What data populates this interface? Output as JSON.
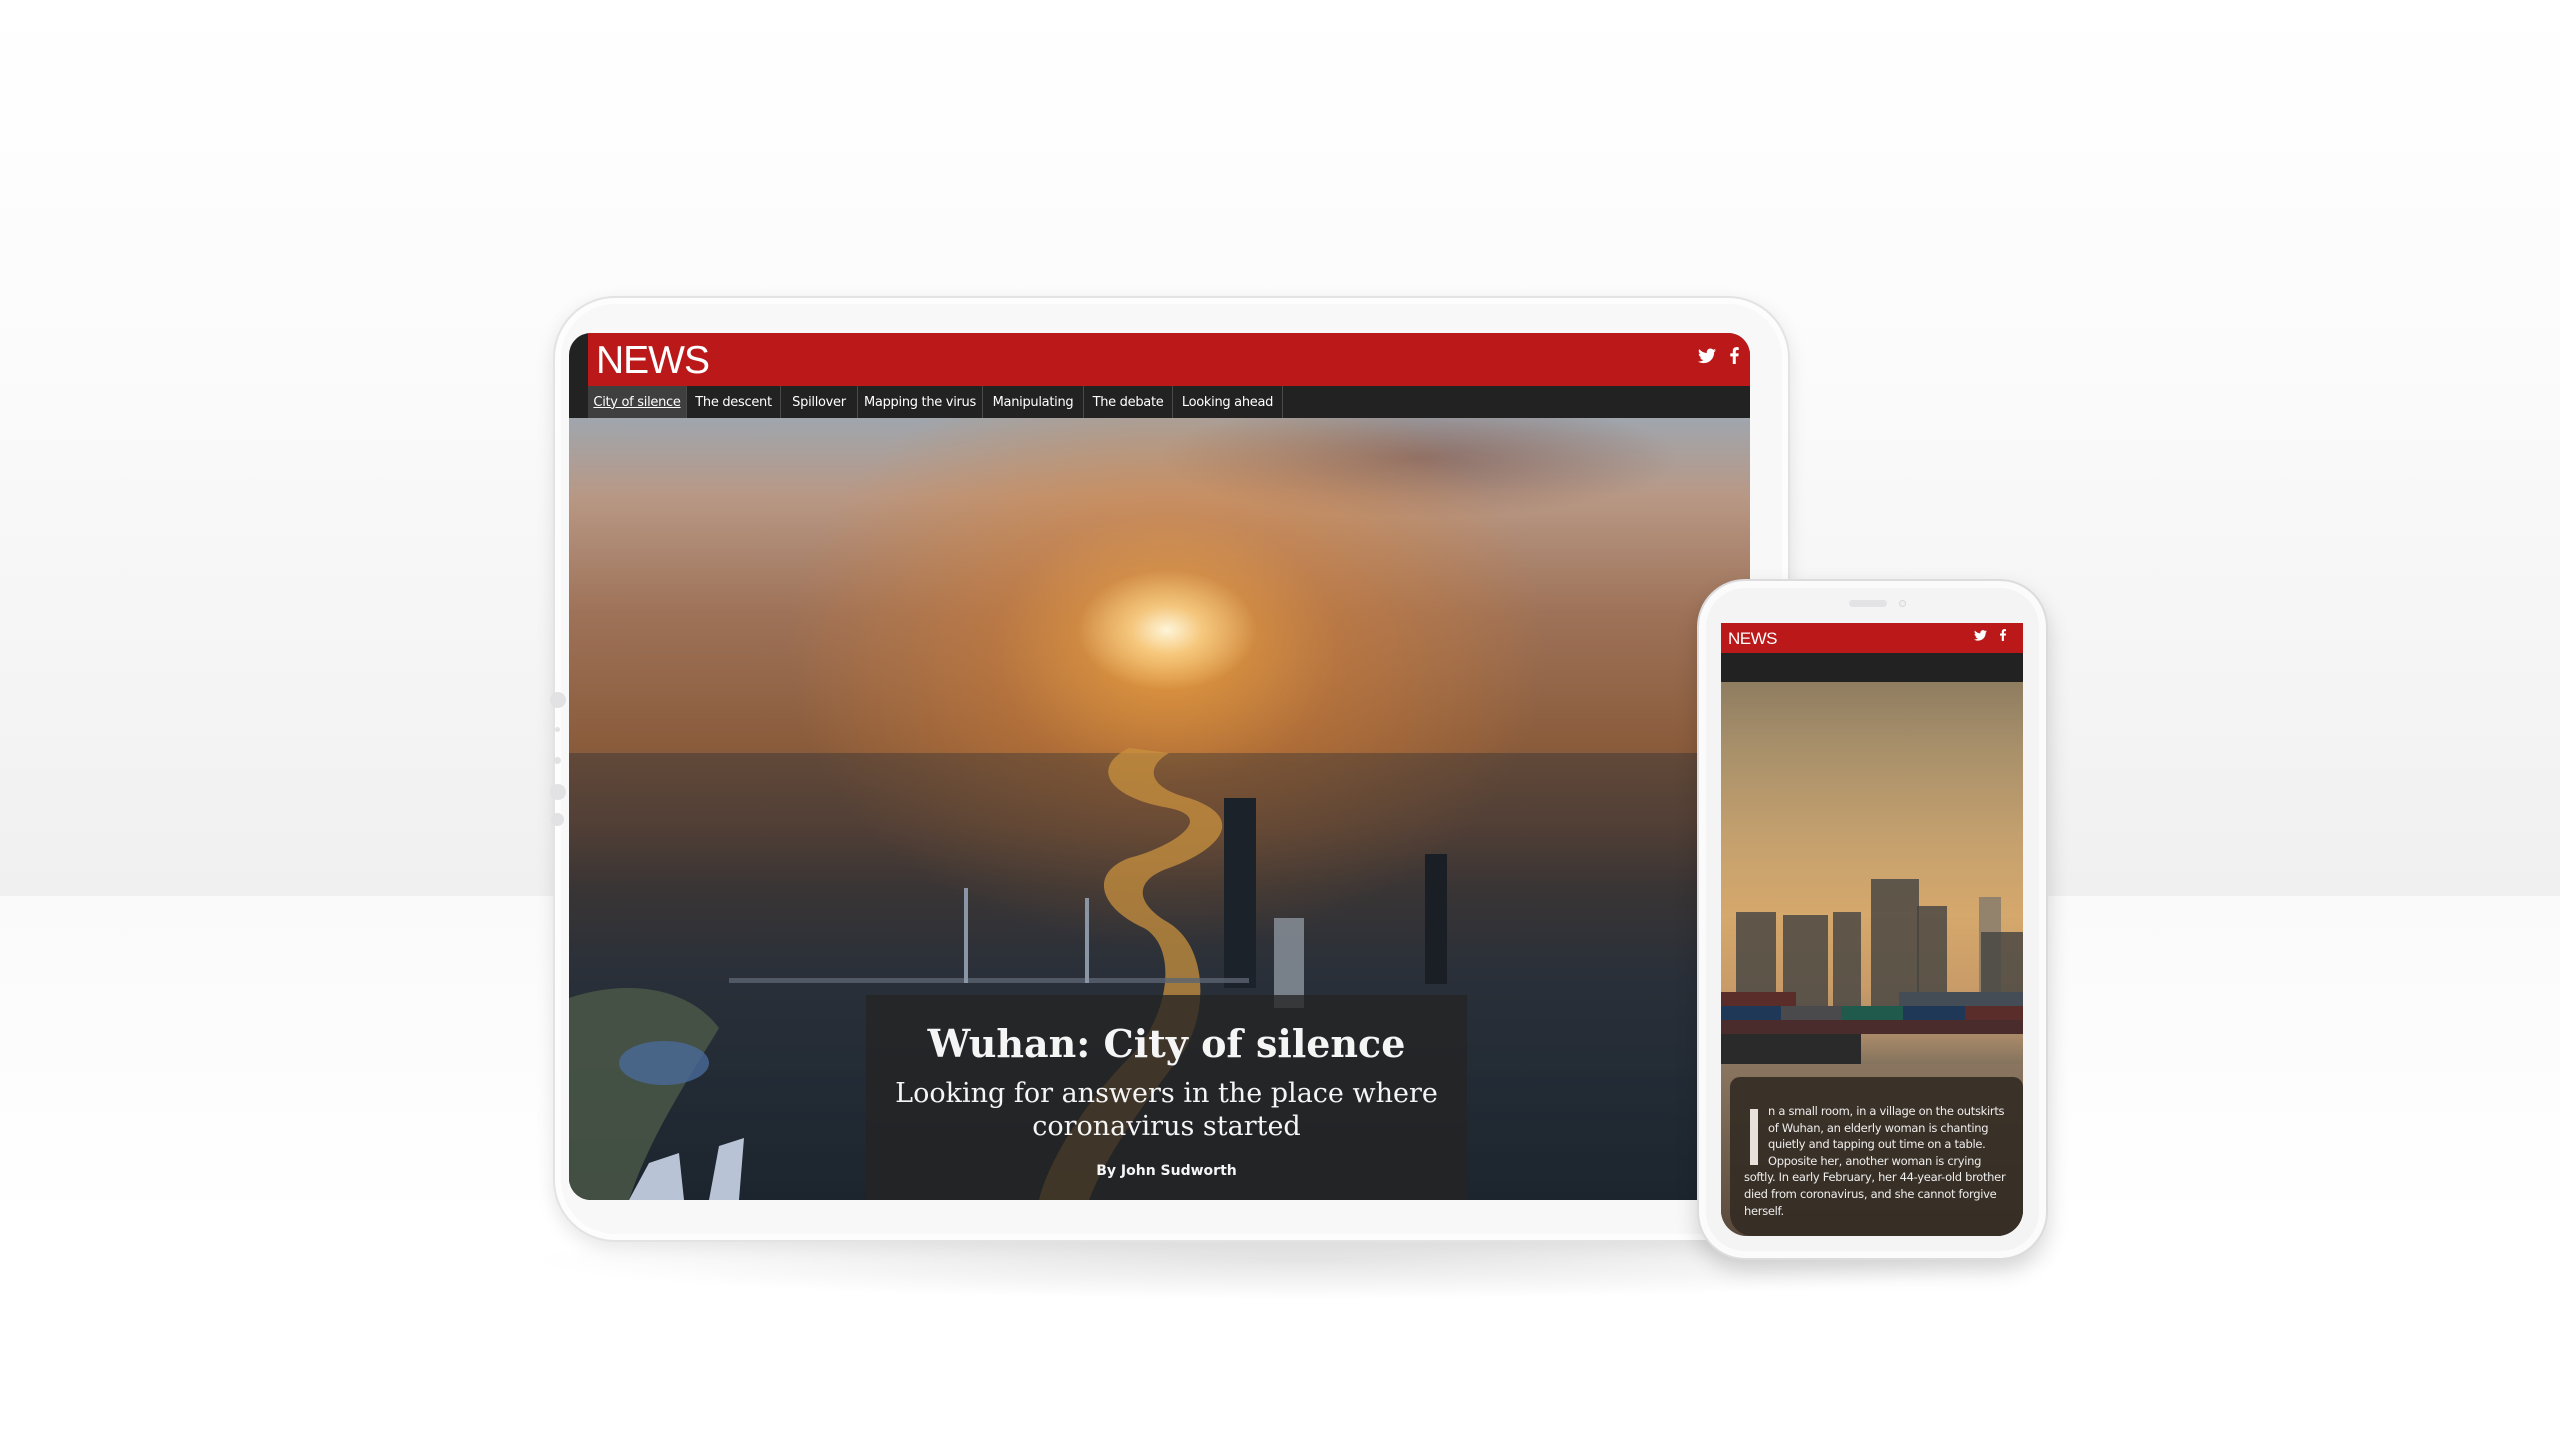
{
  "tablet": {
    "brand": "NEWS",
    "social": {
      "twitter": "twitter-icon",
      "facebook": "facebook-icon"
    },
    "nav_tabs": [
      {
        "label": "City of silence",
        "active": true
      },
      {
        "label": "The descent",
        "active": false
      },
      {
        "label": "Spillover",
        "active": false
      },
      {
        "label": "Mapping the virus",
        "active": false
      },
      {
        "label": "Manipulating",
        "active": false
      },
      {
        "label": "The debate",
        "active": false
      },
      {
        "label": "Looking ahead",
        "active": false
      }
    ],
    "article": {
      "title": "Wuhan: City of silence",
      "subtitle": "Looking for answers in the place where coronavirus started",
      "byline": "By John Sudworth"
    }
  },
  "phone": {
    "brand": "NEWS",
    "social": {
      "twitter": "twitter-icon",
      "facebook": "facebook-icon"
    },
    "intro": {
      "dropcap": "I",
      "indented_lines": [
        "n a small room, in a village on the outskirts",
        "of Wuhan, an elderly woman is chanting",
        "quietly and tapping out time on a table.",
        "Opposite her, another woman is crying"
      ],
      "lines": [
        "softly. In early February, her 44-year-old brother",
        "died from coronavirus, and she cannot forgive",
        "herself."
      ]
    }
  },
  "colors": {
    "brand_red": "#bb1919",
    "nav_bg": "#222222",
    "nav_active": "#3f3f3f"
  }
}
